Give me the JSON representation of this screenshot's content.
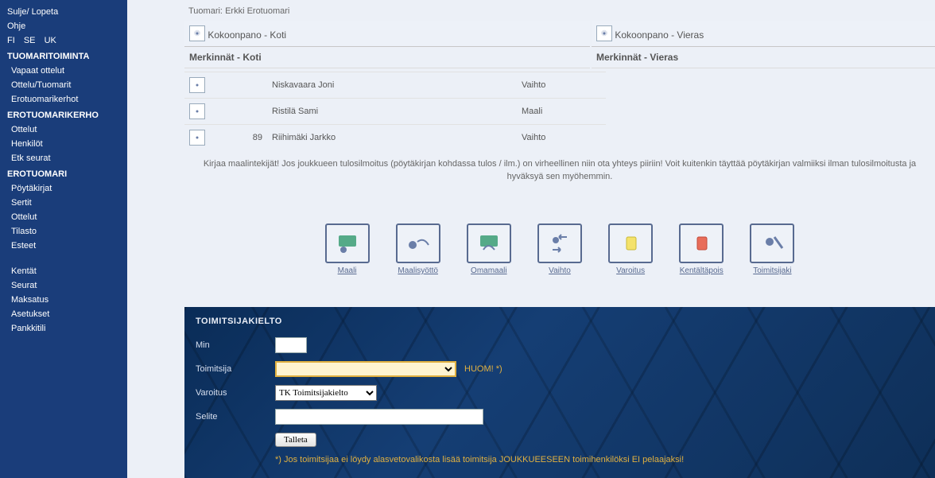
{
  "sidebar": {
    "top_links": [
      {
        "label": "Sulje/ Lopeta",
        "name": "close-quit"
      },
      {
        "label": "Ohje",
        "name": "help"
      }
    ],
    "langs": [
      "FI",
      "SE",
      "UK"
    ],
    "groups": [
      {
        "heading": "TUOMARITOIMINTA",
        "items": [
          {
            "label": "Vapaat ottelut"
          },
          {
            "label": "Ottelu/Tuomarit"
          },
          {
            "label": "Erotuomarikerhot"
          }
        ]
      },
      {
        "heading": "EROTUOMARIKERHO",
        "items": [
          {
            "label": "Ottelut"
          },
          {
            "label": "Henkilöt"
          },
          {
            "label": "Etk seurat"
          }
        ]
      },
      {
        "heading": "EROTUOMARI",
        "items": [
          {
            "label": "Pöytäkirjat"
          },
          {
            "label": "Sertit"
          },
          {
            "label": "Ottelut"
          },
          {
            "label": "Tilasto"
          },
          {
            "label": "Esteet"
          }
        ]
      },
      {
        "heading": "",
        "items": [
          {
            "label": "Kentät"
          },
          {
            "label": "Seurat"
          },
          {
            "label": "Maksatus"
          },
          {
            "label": "Asetukset"
          },
          {
            "label": "Pankkitili"
          }
        ]
      }
    ]
  },
  "header": {
    "referee_label": "Tuomari:",
    "referee_name": "Erkki Erotuomari"
  },
  "sections": {
    "home_roster": "Kokoonpano - Koti",
    "away_roster": "Kokoonpano - Vieras",
    "home_events": "Merkinnät - Koti",
    "away_events": "Merkinnät - Vieras"
  },
  "events_home": [
    {
      "min": "",
      "player": "Niskavaara Joni",
      "type": "Vaihto"
    },
    {
      "min": "",
      "player": "Ristilä Sami",
      "type": "Maali"
    },
    {
      "min": "89",
      "player": "Riihimäki Jarkko",
      "type": "Vaihto"
    }
  ],
  "note": "Kirjaa maalintekijät! Jos joukkueen tulosilmoitus (pöytäkirjan kohdassa tulos / ilm.) on virheellinen niin ota yhteys piiriin! Voit kuitenkin täyttää pöytäkirjan valmiiksi ilman tulosilmoitusta ja hyväksyä sen myöhemmin.",
  "action_icons": [
    {
      "label": "Maali",
      "name": "goal"
    },
    {
      "label": "Maalisyöttö",
      "name": "assist"
    },
    {
      "label": "Omamaali",
      "name": "own-goal"
    },
    {
      "label": "Vaihto",
      "name": "substitution"
    },
    {
      "label": "Varoitus",
      "name": "warning"
    },
    {
      "label": "Kentältäpois",
      "name": "send-off"
    },
    {
      "label": "Toimitsijaki",
      "name": "official-ban"
    }
  ],
  "form": {
    "title": "TOIMITSIJAKIELTO",
    "fields": {
      "min": {
        "label": "Min",
        "value": ""
      },
      "toimitsija": {
        "label": "Toimitsija",
        "value": "",
        "note": "HUOM! *)"
      },
      "varoitus": {
        "label": "Varoitus",
        "selected": "TK Toimitsijakielto"
      },
      "selite": {
        "label": "Selite",
        "value": ""
      }
    },
    "submit": "Talleta",
    "footnote": "*) Jos toimitsijaa ei löydy alasvetovalikosta lisää toimitsija JOUKKUEESEEN toimihenkilöksi EI pelaajaksi!"
  },
  "colors": {
    "accent": "#1a3d7a",
    "warn": "#e0b040"
  }
}
